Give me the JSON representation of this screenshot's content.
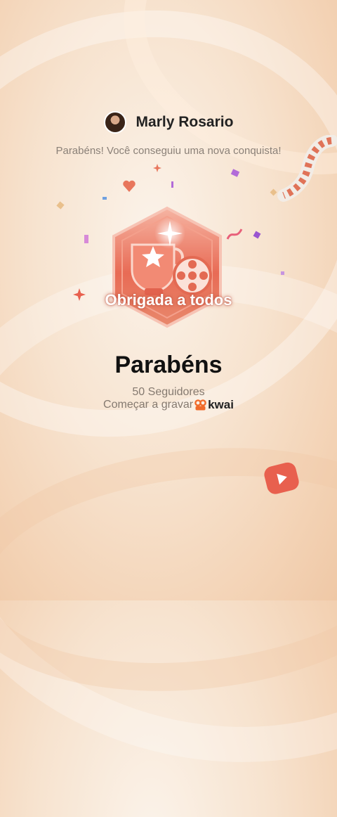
{
  "user": {
    "name": "Marly Rosario"
  },
  "message": {
    "subtitle": "Parabéns! Você conseguiu uma nova conquista!"
  },
  "badge": {
    "caption": "Obrigada a todos",
    "icon": "trophy-film-badge-icon"
  },
  "achievement": {
    "title": "Parabéns",
    "followers": "50 Seguidores",
    "record_label": "Começar a gravar",
    "brand": "kwai"
  },
  "colors": {
    "accent": "#e8604e",
    "badge_light": "#f3a08d",
    "text_dark": "#222222",
    "text_muted": "#857a70"
  }
}
